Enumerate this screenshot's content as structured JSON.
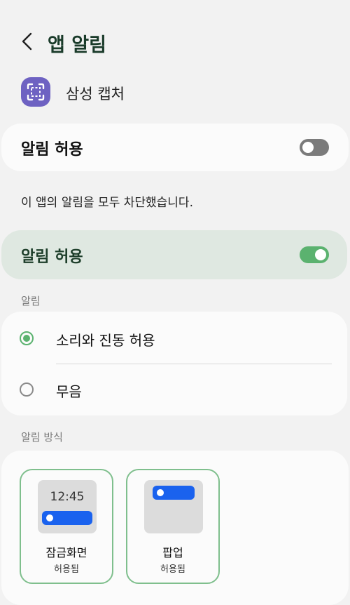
{
  "header": {
    "title": "앱 알림",
    "back_icon": "chevron-left-icon"
  },
  "app": {
    "name": "삼성 캡처",
    "icon": "screen-capture-icon",
    "icon_color": "#6e62c2"
  },
  "allow_notifications": {
    "label": "알림 허용",
    "state": "off"
  },
  "info_text": "이 앱의 알림을 모두 차단했습니다.",
  "allow_notifications_highlight": {
    "label": "알림 허용",
    "state": "on"
  },
  "notifications_section": {
    "title": "알림",
    "options": [
      {
        "label": "소리와 진동 허용",
        "selected": true
      },
      {
        "label": "무음",
        "selected": false
      }
    ]
  },
  "style_section": {
    "title": "알림 방식",
    "styles": [
      {
        "name": "잠금화면",
        "status": "허용됨",
        "preview_time": "12:45"
      },
      {
        "name": "팝업",
        "status": "허용됨"
      }
    ]
  },
  "colors": {
    "accent": "#5bb26f",
    "popup_pill": "#1a62ee",
    "highlight_card": "#dfe8e1"
  }
}
